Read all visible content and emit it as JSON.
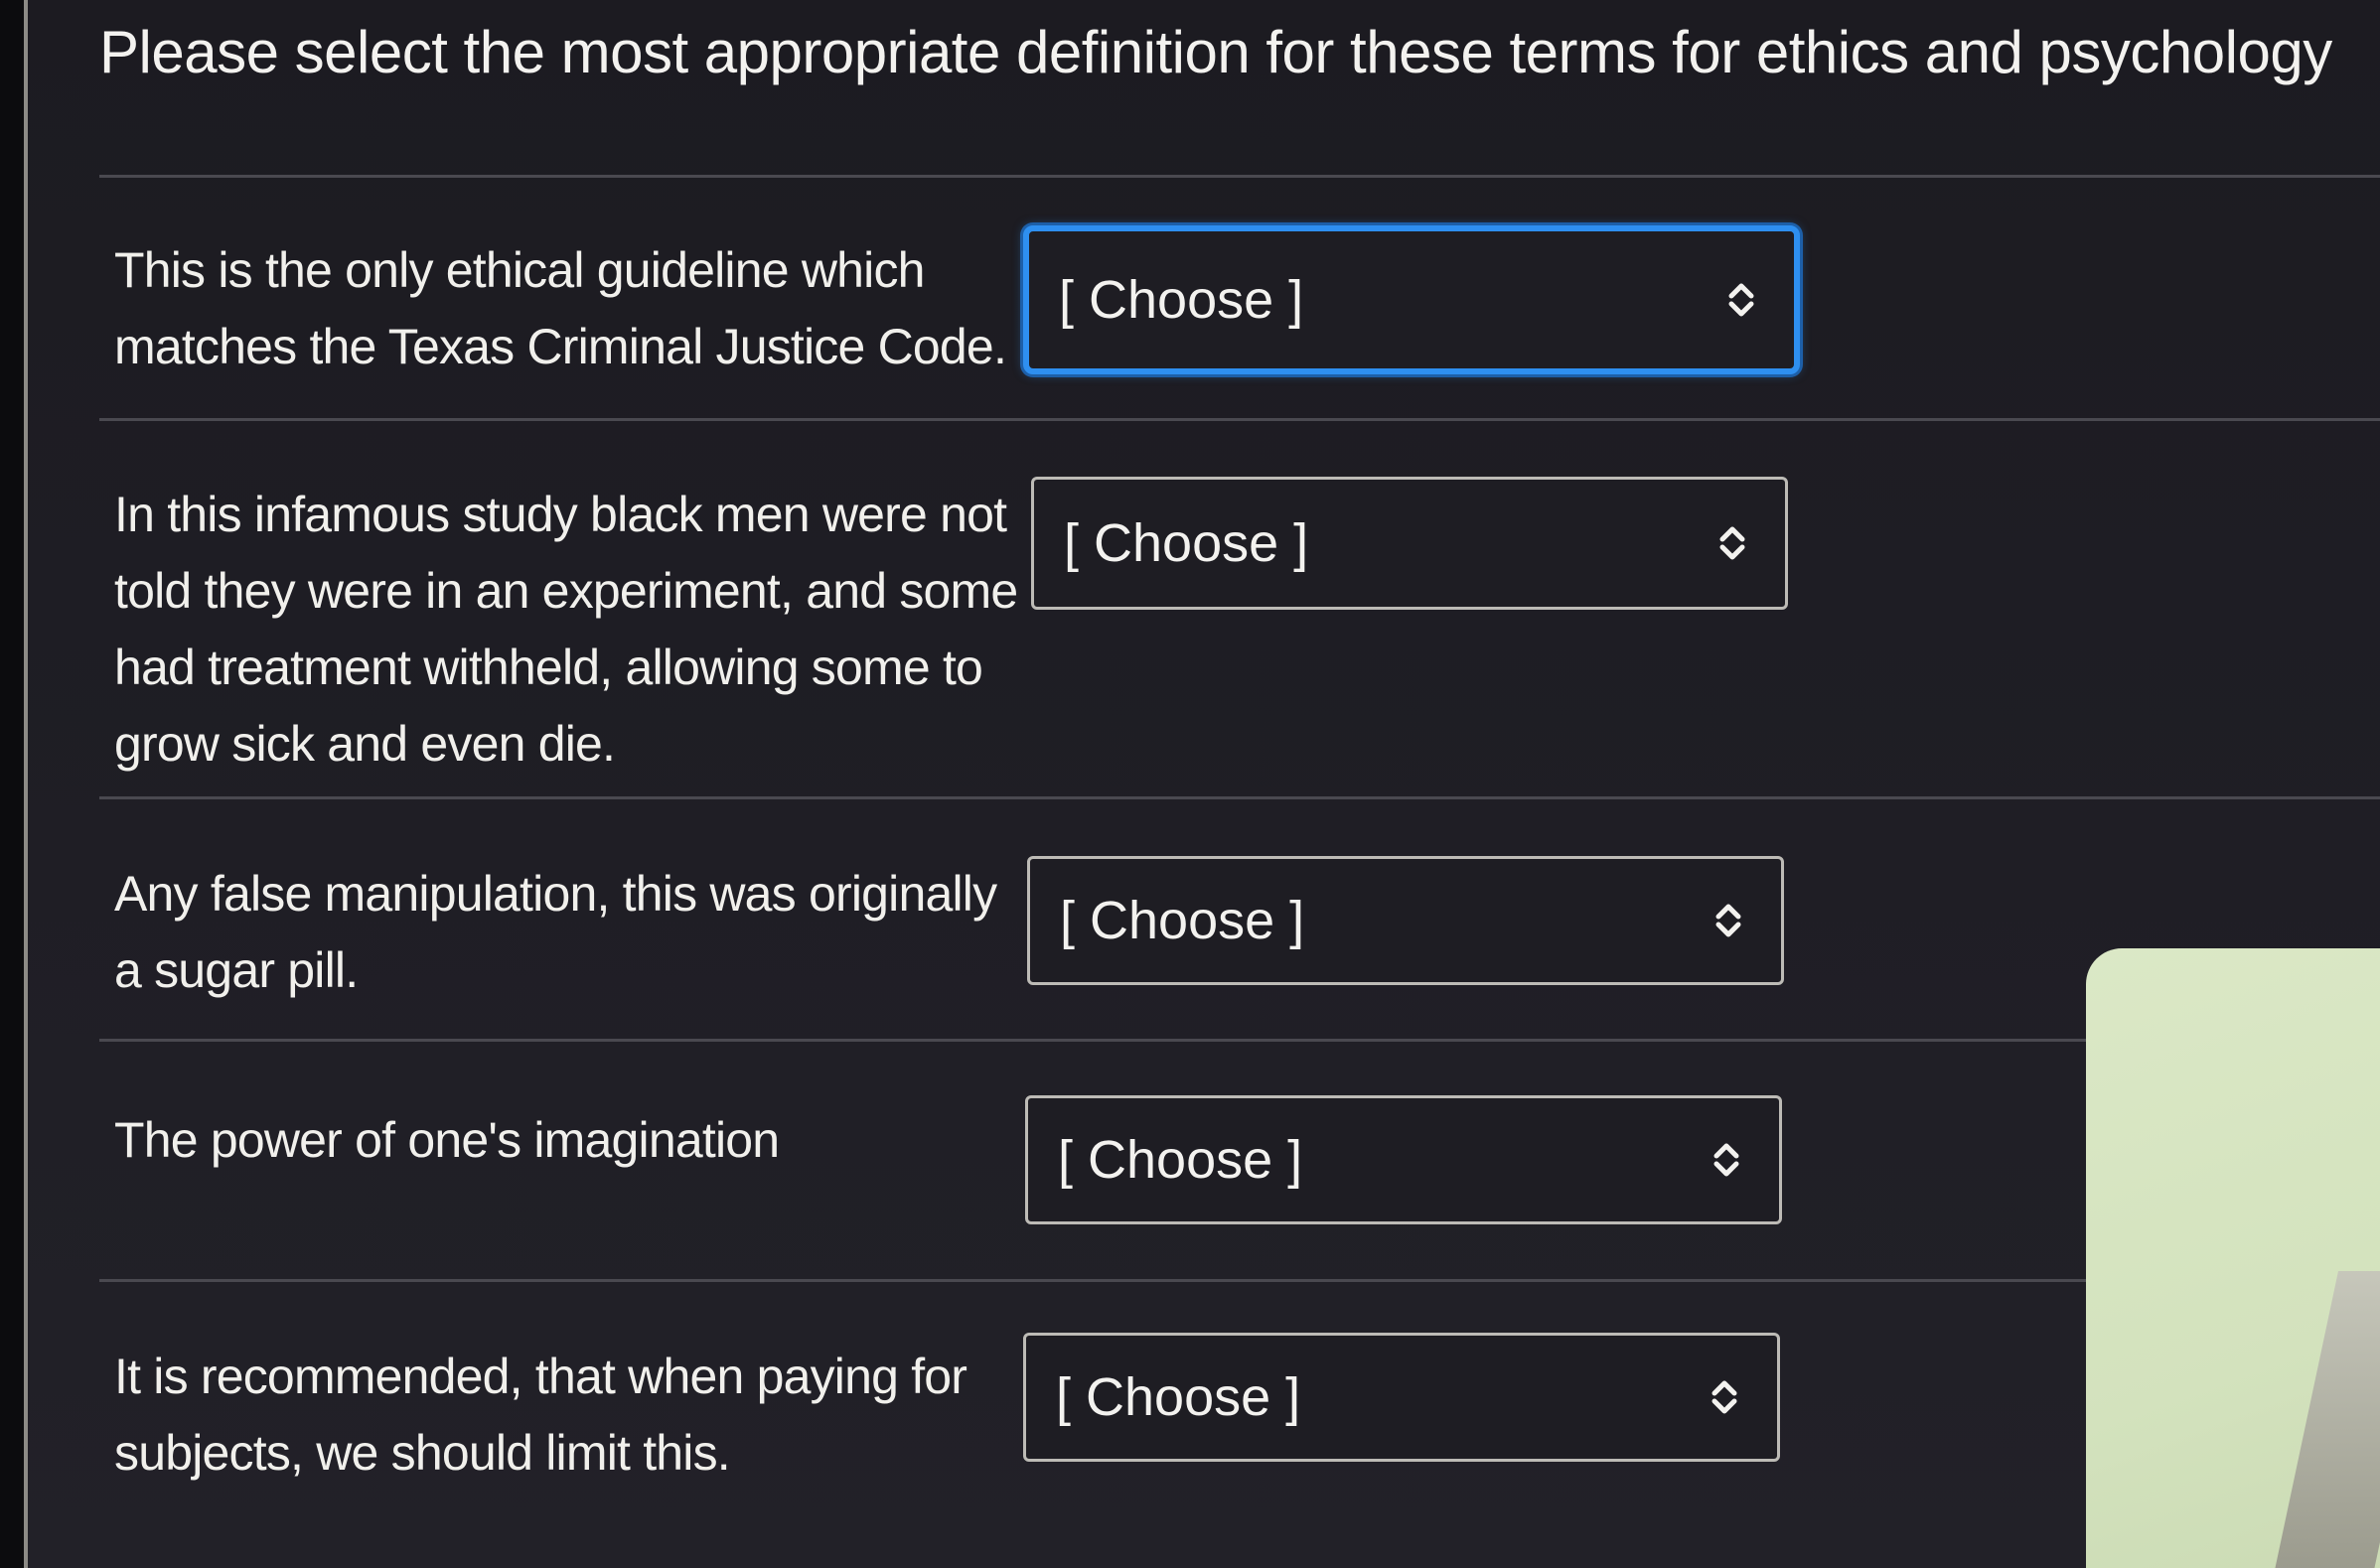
{
  "page": {
    "title": "Please select the most appropriate definition for these terms for ethics and psychology"
  },
  "questions": [
    {
      "text": "This is the only ethical guideline which matches the Texas Criminal Justice Code.",
      "select_value": "[ Choose ]",
      "focused": true
    },
    {
      "text": "In this infamous study black men were not told they were in an experiment, and some had treatment withheld, allowing some to grow sick and even die.",
      "select_value": "[ Choose ]",
      "focused": false
    },
    {
      "text": "Any false manipulation, this was originally a sugar pill.",
      "select_value": "[ Choose ]",
      "focused": false
    },
    {
      "text": "The power of one's imagination",
      "select_value": "[ Choose ]",
      "focused": false
    },
    {
      "text": "It is recommended, that when paying for subjects, we should limit this.",
      "select_value": "[ Choose ]",
      "focused": false
    }
  ],
  "icons": {
    "select_arrow": "up-down-chevron-icon"
  },
  "colors": {
    "background": "#1d1c22",
    "text": "#f1f0ec",
    "focus_ring": "#2e8ff0",
    "select_border": "#bdbbb6"
  }
}
